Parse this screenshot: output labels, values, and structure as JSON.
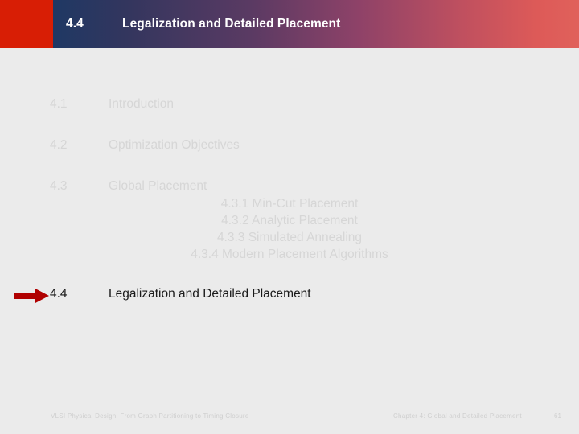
{
  "slide": {
    "background_color": "#ebebeb",
    "page_number": "61"
  },
  "header": {
    "accent_color": "#d81e05",
    "gradient_start": "#1f3864",
    "gradient_end": "#e0615b",
    "number": "4.4",
    "heading": "Legalization and Detailed Placement"
  },
  "outline": {
    "active_color": "#1a1a1a",
    "inactive_color": "#d6d6d6",
    "items": [
      {
        "num": "4.1",
        "label": "Introduction",
        "active": false
      },
      {
        "num": "4.2",
        "label": "Optimization Objectives",
        "active": false
      },
      {
        "num": "4.3",
        "label": "Global Placement",
        "active": false
      },
      {
        "num": "4.4",
        "label": "Legalization and Detailed Placement",
        "active": true
      }
    ],
    "subitems": [
      {
        "text": "4.3.1  Min-Cut Placement"
      },
      {
        "text": "4.3.2  Analytic Placement"
      },
      {
        "text": "4.3.3  Simulated Annealing"
      },
      {
        "text": "4.3.4  Modern Placement Algorithms"
      }
    ]
  },
  "pointer": {
    "color": "#b00000",
    "target": "4.4"
  },
  "footer": {
    "left": "VLSI Physical Design: From Graph Partitioning to Timing Closure",
    "right": "Chapter 4: Global and Detailed Placement",
    "page": "61"
  }
}
